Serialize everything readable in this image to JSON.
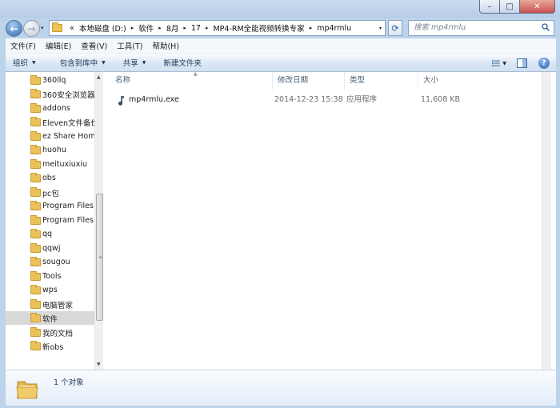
{
  "window": {
    "min_glyph": "–",
    "max_glyph": "□",
    "close_glyph": "✕"
  },
  "nav": {
    "back_glyph": "←",
    "forward_glyph": "→",
    "history_glyph": "▾"
  },
  "address": {
    "overflow": "«",
    "crumbs": [
      "本地磁盘 (D:)",
      "软件",
      "8月",
      "17",
      "MP4-RM全能视频转换专家",
      "mp4rmlu"
    ],
    "separator": "▸",
    "refresh_glyph": "⟳"
  },
  "search": {
    "placeholder": "搜索 mp4rmlu"
  },
  "menu": [
    "文件(F)",
    "编辑(E)",
    "查看(V)",
    "工具(T)",
    "帮助(H)"
  ],
  "toolbar": {
    "organize": "组织",
    "include_library": "包含到库中",
    "share": "共享",
    "new_folder": "新建文件夹",
    "caret": "▼",
    "help_glyph": "?"
  },
  "sidebar": {
    "items": [
      {
        "label": "360llq"
      },
      {
        "label": "360安全浏览器"
      },
      {
        "label": "addons"
      },
      {
        "label": "Eleven文件备份"
      },
      {
        "label": "ez Share Hom"
      },
      {
        "label": "huohu"
      },
      {
        "label": "meituxiuxiu"
      },
      {
        "label": "obs"
      },
      {
        "label": "pc包"
      },
      {
        "label": "Program Files"
      },
      {
        "label": "Program Files"
      },
      {
        "label": "qq"
      },
      {
        "label": "qqwj"
      },
      {
        "label": "sougou"
      },
      {
        "label": "Tools"
      },
      {
        "label": "wps"
      },
      {
        "label": "电脑管家"
      },
      {
        "label": "软件",
        "selected": true
      },
      {
        "label": "我的文档"
      },
      {
        "label": "新obs"
      }
    ],
    "scroll_up": "▲",
    "scroll_down": "▼",
    "grip": "≡"
  },
  "file_list": {
    "columns": {
      "name": "名称",
      "date": "修改日期",
      "type": "类型",
      "size": "大小"
    },
    "sort_glyph": "▲",
    "rows": [
      {
        "name": "mp4rmlu.exe",
        "date": "2014-12-23 15:38",
        "type": "应用程序",
        "size": "11,608 KB"
      }
    ]
  },
  "details": {
    "count_text": "1 个对象"
  },
  "colors": {
    "accent": "#2f6bb4",
    "folder": "#e9c25a",
    "close": "#c75050"
  }
}
